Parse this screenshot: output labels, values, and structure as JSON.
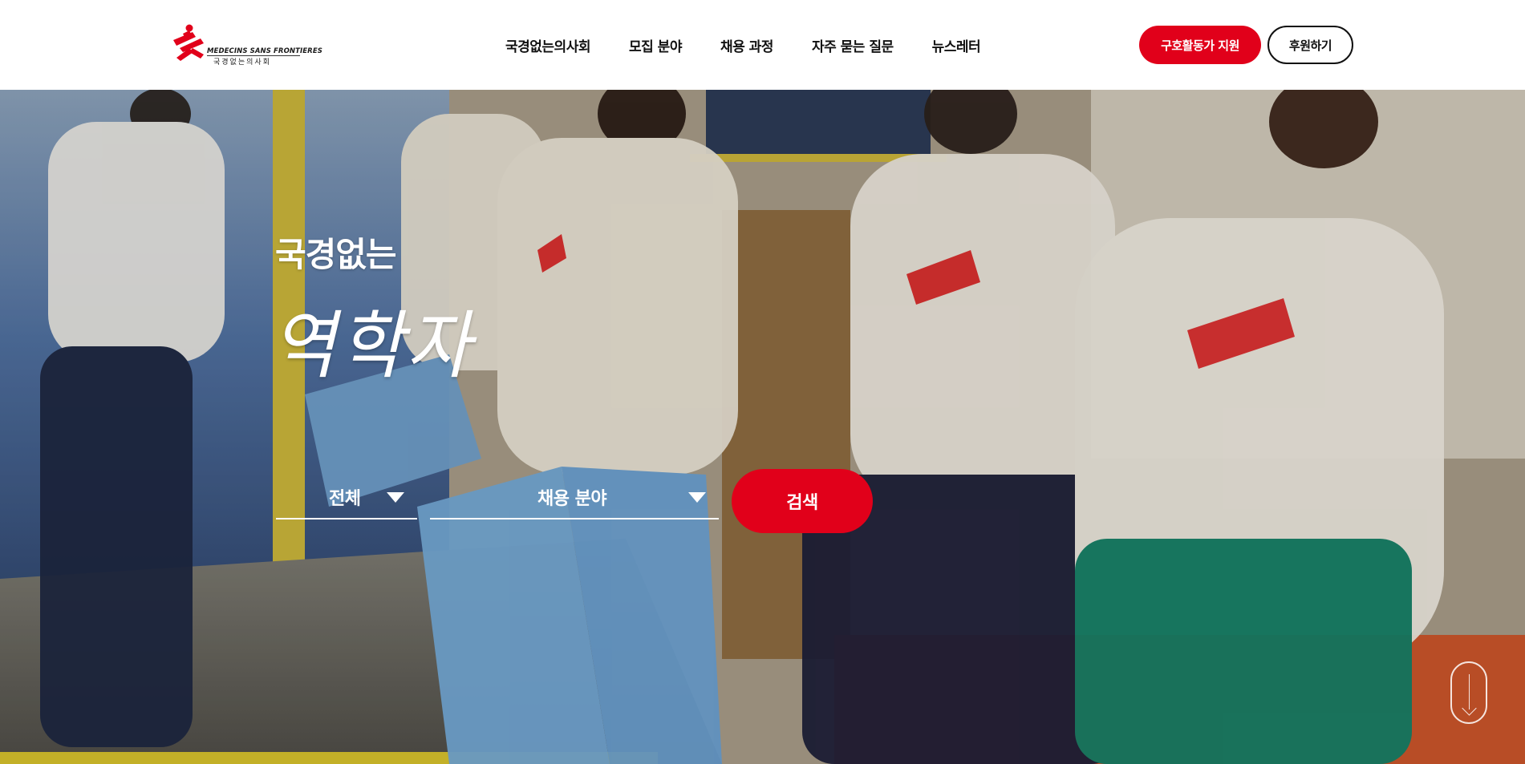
{
  "header": {
    "logo": {
      "name_en": "MEDECINS SANS FRONTIERES",
      "name_ko": "국경없는의사회",
      "icon": "msf-running-man-logo",
      "color": "#e1001a"
    },
    "nav": [
      "국경없는의사회",
      "모집 분야",
      "채용 과정",
      "자주 묻는 질문",
      "뉴스레터"
    ],
    "buttons": {
      "apply": "구호활동가 지원",
      "donate": "후원하기"
    }
  },
  "hero": {
    "title_small": "국경없는",
    "title_large": "역학자",
    "filters": {
      "region": "전체",
      "field": "채용 분야"
    },
    "search_label": "검색",
    "scroll_icon": "scroll-down-arrow-icon"
  },
  "colors": {
    "accent": "#e1001a",
    "text": "#111111",
    "header_bg": "#ffffff"
  }
}
